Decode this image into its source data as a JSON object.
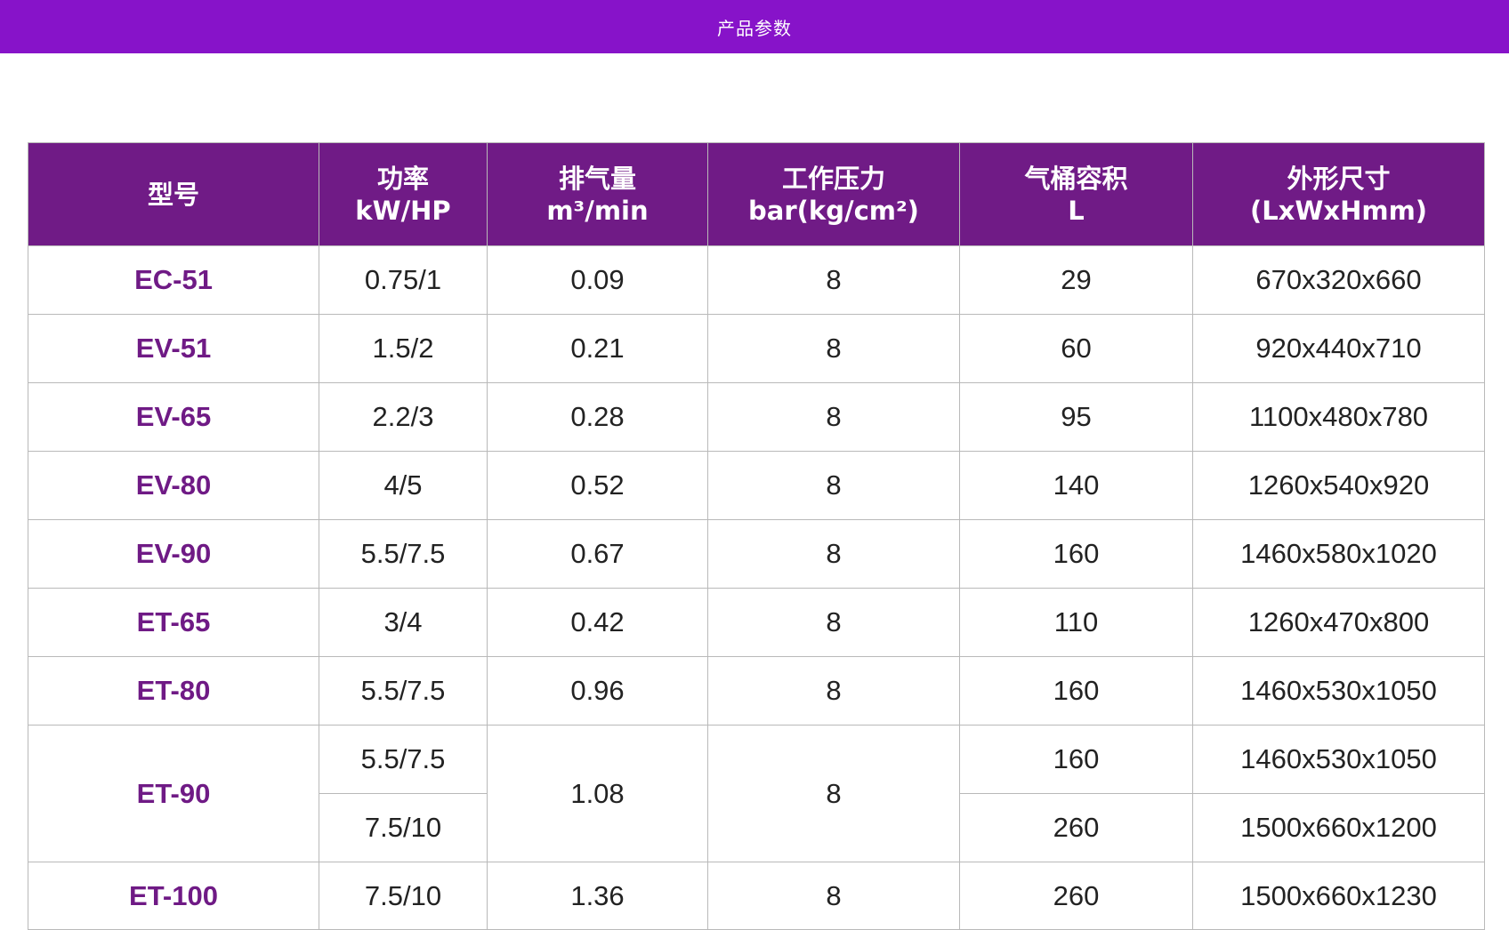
{
  "page": {
    "title": "产品参数",
    "accent_color": "#8713c9",
    "header_color": "#701b86",
    "model_text_color": "#6f1a85"
  },
  "table": {
    "headers": [
      {
        "line1": "型号",
        "line2": ""
      },
      {
        "line1": "功率",
        "line2": "kW/HP"
      },
      {
        "line1": "排气量",
        "line2": "m³/min"
      },
      {
        "line1": "工作压力",
        "line2": "bar(kg/cm²)"
      },
      {
        "line1": "气桶容积",
        "line2": "L"
      },
      {
        "line1": "外形尺寸",
        "line2": "(LxWxHmm)"
      }
    ],
    "rows": [
      {
        "model": "EC-51",
        "power": "0.75/1",
        "air": "0.09",
        "pressure": "8",
        "tank": "29",
        "size": "670x320x660"
      },
      {
        "model": "EV-51",
        "power": "1.5/2",
        "air": "0.21",
        "pressure": "8",
        "tank": "60",
        "size": "920x440x710"
      },
      {
        "model": "EV-65",
        "power": "2.2/3",
        "air": "0.28",
        "pressure": "8",
        "tank": "95",
        "size": "1100x480x780"
      },
      {
        "model": "EV-80",
        "power": "4/5",
        "air": "0.52",
        "pressure": "8",
        "tank": "140",
        "size": "1260x540x920"
      },
      {
        "model": "EV-90",
        "power": "5.5/7.5",
        "air": "0.67",
        "pressure": "8",
        "tank": "160",
        "size": "1460x580x1020"
      },
      {
        "model": "ET-65",
        "power": "3/4",
        "air": "0.42",
        "pressure": "8",
        "tank": "110",
        "size": "1260x470x800"
      },
      {
        "model": "ET-80",
        "power": "5.5/7.5",
        "air": "0.96",
        "pressure": "8",
        "tank": "160",
        "size": "1460x530x1050"
      }
    ],
    "et90": {
      "model": "ET-90",
      "air": "1.08",
      "pressure": "8",
      "variants": [
        {
          "power": "5.5/7.5",
          "tank": "160",
          "size": "1460x530x1050"
        },
        {
          "power": "7.5/10",
          "tank": "260",
          "size": "1500x660x1200"
        }
      ]
    },
    "last_row": {
      "model": "ET-100",
      "power": "7.5/10",
      "air": "1.36",
      "pressure": "8",
      "tank": "260",
      "size": "1500x660x1230"
    }
  }
}
